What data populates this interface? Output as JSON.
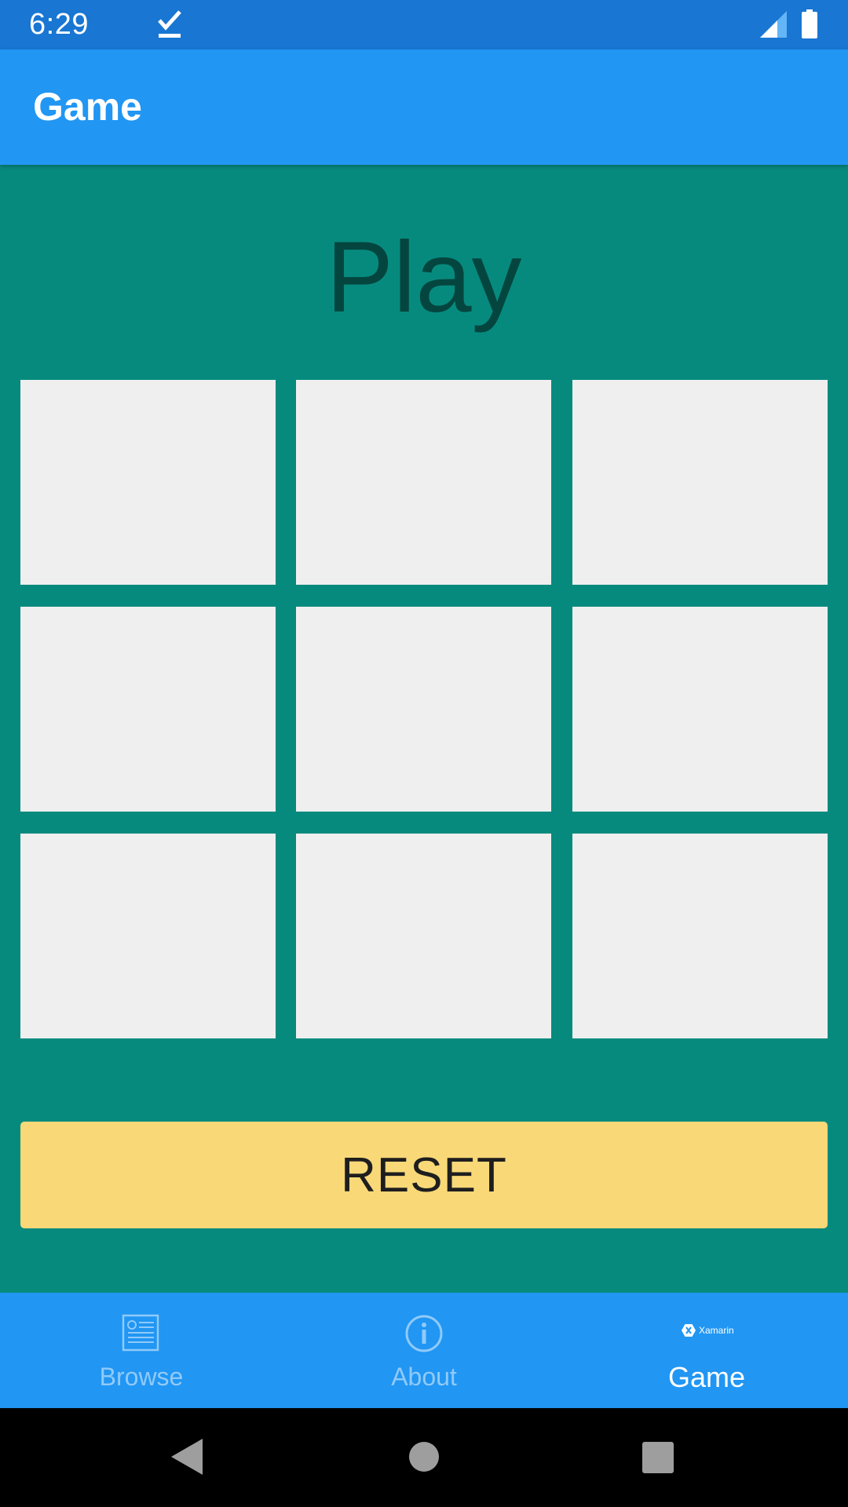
{
  "status_bar": {
    "time": "6:29",
    "icons": [
      "checkmark-icon",
      "signal-icon",
      "battery-icon"
    ]
  },
  "app_bar": {
    "title": "Game"
  },
  "main": {
    "heading": "Play",
    "board": {
      "rows": 3,
      "columns": 3,
      "cells": [
        "",
        "",
        "",
        "",
        "",
        "",
        "",
        "",
        ""
      ]
    },
    "reset_label": "RESET"
  },
  "tab_bar": {
    "tabs": [
      {
        "label": "Browse",
        "icon": "browse-icon",
        "selected": false
      },
      {
        "label": "About",
        "icon": "info-icon",
        "selected": false
      },
      {
        "label": "Game",
        "icon": "xamarin-logo",
        "selected": true,
        "logo_text": "Xamarin"
      }
    ]
  },
  "nav_bar": {
    "icons": [
      "back-icon",
      "home-icon",
      "recents-icon"
    ]
  },
  "colors": {
    "status_bar": "#1976d2",
    "app_bar": "#2196f3",
    "background": "#078a7e",
    "heading": "#04463f",
    "cell": "#efefef",
    "reset_button": "#f9d878",
    "tab_inactive": "#90caf9",
    "tab_active": "#ffffff"
  }
}
